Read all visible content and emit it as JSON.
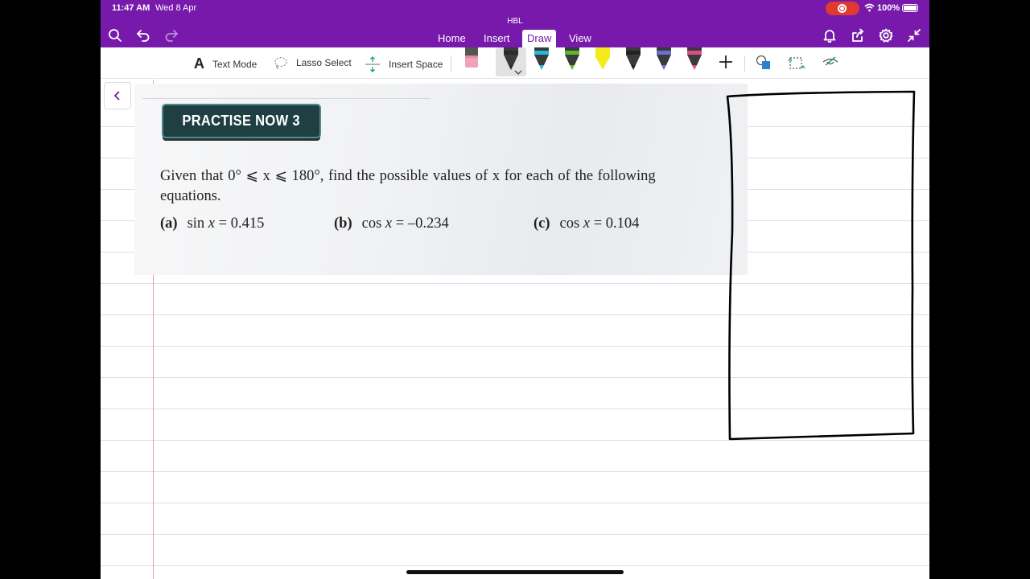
{
  "status": {
    "time": "11:47 AM",
    "date": "Wed 8 Apr",
    "battery": "100%"
  },
  "header": {
    "title": "HBL",
    "tabs": [
      {
        "label": "Home"
      },
      {
        "label": "Insert"
      },
      {
        "label": "Draw"
      },
      {
        "label": "View"
      }
    ],
    "active_tab": "Draw"
  },
  "toolbar": {
    "text_mode": "Text Mode",
    "lasso_select": "Lasso Select",
    "insert_space": "Insert Space",
    "pens": [
      {
        "name": "black-pen",
        "color": "#2b2b2b"
      },
      {
        "name": "cyan-pen",
        "color": "#22b8d6"
      },
      {
        "name": "green-pen",
        "color": "#5bb82e"
      },
      {
        "name": "yellow-highlighter",
        "color": "#f4ec1a"
      },
      {
        "name": "dark-pen",
        "color": "#222222"
      },
      {
        "name": "galaxy-pen",
        "color": "#6a6fd6"
      },
      {
        "name": "rainbow-pen",
        "color": "#e04a8a"
      }
    ],
    "eraser_color": "#f0a3b8"
  },
  "page": {
    "badge": "PRACTISE NOW 3",
    "question_line1": "Given that 0° ⩽ x ⩽ 180°, find the possible values of x for each of the following",
    "question_line2": "equations.",
    "parts": [
      {
        "label": "(a)",
        "func": "sin",
        "var": "x",
        "rhs": "= 0.415"
      },
      {
        "label": "(b)",
        "func": "cos",
        "var": "x",
        "rhs": "= –0.234"
      },
      {
        "label": "(c)",
        "func": "cos",
        "var": "x",
        "rhs": "= 0.104"
      }
    ]
  },
  "colors": {
    "accent": "#7719aa",
    "margin": "#e8a0a0",
    "rule": "#d6e0ea"
  }
}
